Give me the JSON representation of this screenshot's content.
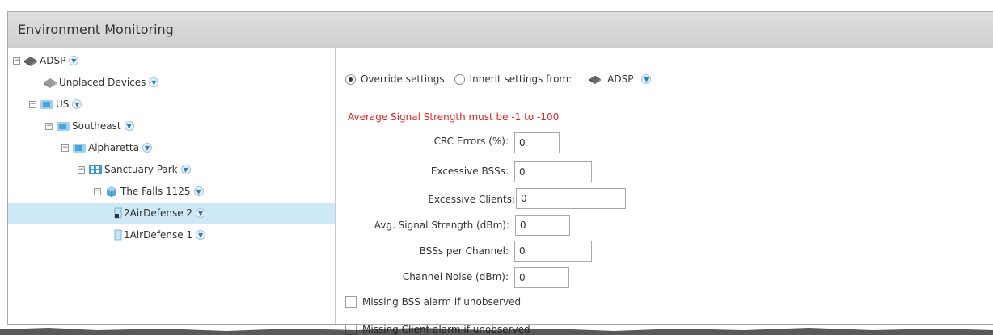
{
  "panel": {
    "title": "Environment Monitoring"
  },
  "tree": {
    "nodes": [
      {
        "label": "ADSP"
      },
      {
        "label": "Unplaced Devices"
      },
      {
        "label": "US"
      },
      {
        "label": "Southeast"
      },
      {
        "label": "Alpharetta"
      },
      {
        "label": "Sanctuary Park"
      },
      {
        "label": "The Falls 1125"
      },
      {
        "label": "AirDefense 2",
        "prefix": "2",
        "selected": true
      },
      {
        "label": "AirDefense 1",
        "prefix": "1"
      }
    ],
    "expander": "⊟"
  },
  "settings": {
    "override_label": "Override settings",
    "inherit_label": "Inherit settings from:",
    "inherit_source": "ADSP",
    "override_selected": true,
    "error": "Average Signal Strength must be -1 to -100",
    "fields": [
      {
        "label": "CRC Errors (%):",
        "value": "0"
      },
      {
        "label": "Excessive BSSs:",
        "value": "0"
      },
      {
        "label": "Excessive Clients:",
        "value": "0"
      },
      {
        "label": "Avg. Signal Strength (dBm):",
        "value": "0"
      },
      {
        "label": "BSSs per Channel:",
        "value": "0"
      },
      {
        "label": "Channel Noise (dBm):",
        "value": "0"
      }
    ],
    "checkboxes": [
      {
        "label": "Missing BSS alarm if unobserved",
        "checked": false
      },
      {
        "label": "Missing Client alarm if unobserved",
        "checked": false
      }
    ]
  },
  "colors": {
    "selected_row": "#cde8f7",
    "error_text": "#e81e1e",
    "chevron_blue": "#2f7ac9"
  }
}
